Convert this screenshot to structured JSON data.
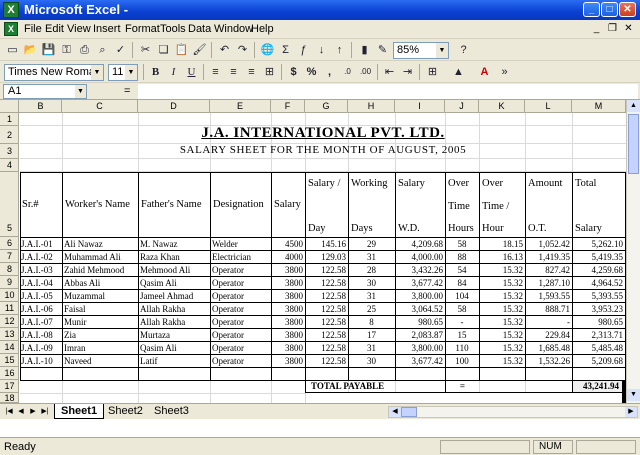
{
  "window": {
    "title": "Microsoft Excel -",
    "icon": "X"
  },
  "menu": [
    "File",
    "Edit",
    "View",
    "Insert",
    "Format",
    "Tools",
    "Data",
    "Window",
    "Help"
  ],
  "toolbar": {
    "zoom": "85%",
    "font_name": "Times New Roman",
    "font_size": "11"
  },
  "formula_bar": {
    "name_box": "A1",
    "fx": "="
  },
  "columns": [
    "B",
    "C",
    "D",
    "E",
    "F",
    "G",
    "H",
    "I",
    "J",
    "K",
    "L",
    "M"
  ],
  "rows": [
    "1",
    "2",
    "3",
    "4",
    "5",
    "6",
    "7",
    "8",
    "9",
    "10",
    "11",
    "12",
    "13",
    "14",
    "15",
    "16",
    "17",
    "18"
  ],
  "sheet": {
    "company": "J.A. INTERNATIONAL PVT. LTD.",
    "subtitle": "SALARY SHEET FOR THE MONTH OF AUGUST, 2005",
    "headers": {
      "sr": "Sr.#",
      "worker": "Worker's Name",
      "father": "Father's Name",
      "designation": "Designation",
      "salary": "Salary",
      "salary_day_1": "Salary /",
      "salary_day_2": "Day",
      "working_1": "Working",
      "working_2": "Days",
      "salary_wd_1": "Salary",
      "salary_wd_2": "W.D.",
      "ot_hours_1": "Over",
      "ot_hours_2": "Time",
      "ot_hours_3": "Hours",
      "ot_hour_1": "Over",
      "ot_hour_2": "Time /",
      "ot_hour_3": "Hour",
      "amount_1": "Amount",
      "amount_2": "O.T.",
      "total_1": "Total",
      "total_2": "Salary"
    },
    "records": [
      [
        "J.A.I.-01",
        "Ali Nawaz",
        "M. Nawaz",
        "Welder",
        "4500",
        "145.16",
        "29",
        "4,209.68",
        "58",
        "18.15",
        "1,052.42",
        "5,262.10"
      ],
      [
        "J.A.I.-02",
        "Muhammad Ali",
        "Raza Khan",
        "Electrician",
        "4000",
        "129.03",
        "31",
        "4,000.00",
        "88",
        "16.13",
        "1,419.35",
        "5,419.35"
      ],
      [
        "J.A.I.-03",
        "Zahid Mehmood",
        "Mehmood Ali",
        "Operator",
        "3800",
        "122.58",
        "28",
        "3,432.26",
        "54",
        "15.32",
        "827.42",
        "4,259.68"
      ],
      [
        "J.A.I.-04",
        "Abbas Ali",
        "Qasim Ali",
        "Operator",
        "3800",
        "122.58",
        "30",
        "3,677.42",
        "84",
        "15.32",
        "1,287.10",
        "4,964.52"
      ],
      [
        "J.A.I.-05",
        "Muzammal",
        "Jameel Ahmad",
        "Operator",
        "3800",
        "122.58",
        "31",
        "3,800.00",
        "104",
        "15.32",
        "1,593.55",
        "5,393.55"
      ],
      [
        "J.A.I.-06",
        "Faisal",
        "Allah Rakha",
        "Operator",
        "3800",
        "122.58",
        "25",
        "3,064.52",
        "58",
        "15.32",
        "888.71",
        "3,953.23"
      ],
      [
        "J.A.I.-07",
        "Munir",
        "Allah Rakha",
        "Operator",
        "3800",
        "122.58",
        "8",
        "980.65",
        "-",
        "15.32",
        "-",
        "980.65"
      ],
      [
        "J.A.I.-08",
        "Zia",
        "Murtaza",
        "Operator",
        "3800",
        "122.58",
        "17",
        "2,083.87",
        "15",
        "15.32",
        "229.84",
        "2,313.71"
      ],
      [
        "J.A.I.-09",
        "Imran",
        "Qasim Ali",
        "Operator",
        "3800",
        "122.58",
        "31",
        "3,800.00",
        "110",
        "15.32",
        "1,685.48",
        "5,485.48"
      ],
      [
        "J.A.I.-10",
        "Naveed",
        "Latif",
        "Operator",
        "3800",
        "122.58",
        "30",
        "3,677.42",
        "100",
        "15.32",
        "1,532.26",
        "5,209.68"
      ]
    ],
    "total_label": "TOTAL PAYABLE",
    "total_eq": "=",
    "total_value": "43,241.94"
  },
  "tabs": [
    "Sheet1",
    "Sheet2",
    "Sheet3"
  ],
  "status": {
    "text": "Ready",
    "num": "NUM"
  }
}
